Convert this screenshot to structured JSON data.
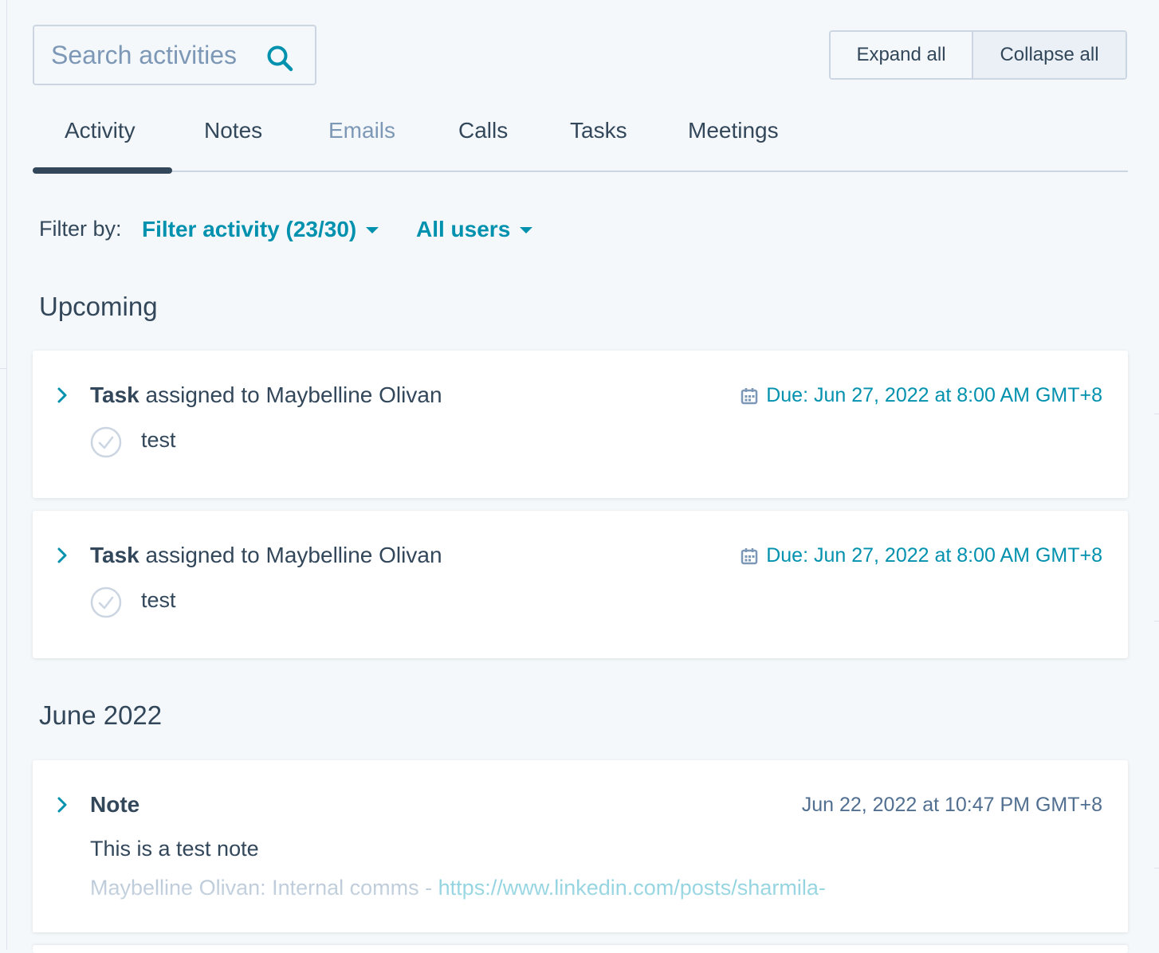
{
  "search": {
    "placeholder": "Search activities",
    "icon": "search-icon"
  },
  "actions": {
    "expand_label": "Expand all",
    "collapse_label": "Collapse all"
  },
  "tabs": [
    {
      "label": "Activity",
      "active": true
    },
    {
      "label": "Notes"
    },
    {
      "label": "Emails",
      "disabled": true
    },
    {
      "label": "Calls"
    },
    {
      "label": "Tasks"
    },
    {
      "label": "Meetings"
    }
  ],
  "filter": {
    "label": "Filter by:",
    "activity_label": "Filter activity (23/30)",
    "users_label": "All users"
  },
  "sections": {
    "upcoming": "Upcoming",
    "june": "June 2022"
  },
  "upcoming_tasks": [
    {
      "type": "Task",
      "assigned_text": "assigned to Maybelline Olivan",
      "due": "Due: Jun 27, 2022 at 8:00 AM GMT+8",
      "task_title": "test"
    },
    {
      "type": "Task",
      "assigned_text": "assigned to Maybelline Olivan",
      "due": "Due: Jun 27, 2022 at 8:00 AM GMT+8",
      "task_title": "test"
    }
  ],
  "note": {
    "type": "Note",
    "timestamp": "Jun 22, 2022 at 10:47 PM GMT+8",
    "body": "This is a test note",
    "preview_prefix": "Maybelline Olivan: Internal comms - ",
    "preview_link": "https://www.linkedin.com/posts/sharmila-"
  },
  "colors": {
    "link": "#0091ae",
    "text": "#33475b",
    "muted": "#7c98b6",
    "background": "#f5f8fa"
  }
}
